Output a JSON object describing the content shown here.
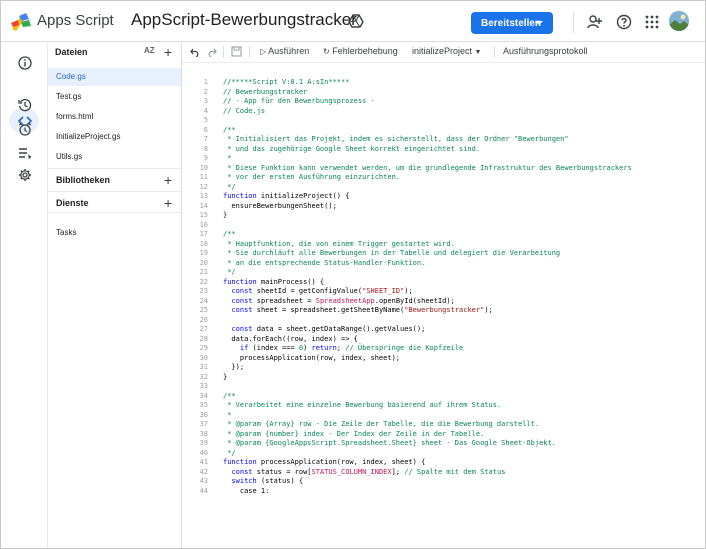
{
  "topbar": {
    "app_name": "Apps Script",
    "project_name": "AppScript-Bewerbungstracker",
    "deploy_label": "Bereitstellen"
  },
  "panel": {
    "files_title": "Dateien",
    "sort_label": "AZ",
    "files": [
      "Code.gs",
      "Test.gs",
      "forms.html",
      "InitializeProject.gs",
      "Utils.gs"
    ],
    "active_file": "Code.gs",
    "libraries_label": "Bibliotheken",
    "services_label": "Dienste",
    "tasks_label": "Tasks"
  },
  "toolbar": {
    "run_label": "Ausführen",
    "debug_label": "Fehlerbehebung",
    "function_select": "initializeProject",
    "log_label": "Ausführungsprotokoll"
  },
  "colors": {
    "accent": "#1a73e8",
    "active_bg": "#e8f0fe",
    "comment": "#098658",
    "keyword": "#0000ff",
    "string": "#a31515",
    "class": "#c2185b"
  },
  "code_lines": [
    [
      [
        "comment",
        "//*****Script V:0.1 A:sIn*****"
      ]
    ],
    [
      [
        "comment",
        "// Bewerbungstracker"
      ]
    ],
    [
      [
        "comment",
        "// - App für den Bewerbungsprozess -"
      ]
    ],
    [
      [
        "comment",
        "// Code.js"
      ]
    ],
    [],
    [
      [
        "comment",
        "/**"
      ]
    ],
    [
      [
        "comment",
        " * Initialisiert das Projekt, indem es sicherstellt, dass der Ordner \"Bewerbungen\""
      ]
    ],
    [
      [
        "comment",
        " * und das zugehörige Google Sheet korrekt eingerichtet sind."
      ]
    ],
    [
      [
        "comment",
        " *"
      ]
    ],
    [
      [
        "comment",
        " * Diese Funktion kann verwendet werden, um die grundlegende Infrastruktur des Bewerbungstrackers"
      ]
    ],
    [
      [
        "comment",
        " * vor der ersten Ausführung einzurichten."
      ]
    ],
    [
      [
        "comment",
        " */"
      ]
    ],
    [
      [
        "keyword",
        "function"
      ],
      [
        "default",
        " initializeProject() {"
      ]
    ],
    [
      [
        "default",
        "  ensureBewerbungenSheet();"
      ]
    ],
    [
      [
        "default",
        "}"
      ]
    ],
    [],
    [
      [
        "comment",
        "/**"
      ]
    ],
    [
      [
        "comment",
        " * Hauptfunktion, die von einem Trigger gestartet wird."
      ]
    ],
    [
      [
        "comment",
        " * Sie durchläuft alle Bewerbungen in der Tabelle und delegiert die Verarbeitung"
      ]
    ],
    [
      [
        "comment",
        " * an die entsprechende Status-Handler-Funktion."
      ]
    ],
    [
      [
        "comment",
        " */"
      ]
    ],
    [
      [
        "keyword",
        "function"
      ],
      [
        "default",
        " mainProcess() {"
      ]
    ],
    [
      [
        "default",
        "  "
      ],
      [
        "keyword",
        "const"
      ],
      [
        "default",
        " sheetId = getConfigValue("
      ],
      [
        "string",
        "\"SHEET_ID\""
      ],
      [
        "default",
        ");"
      ]
    ],
    [
      [
        "default",
        "  "
      ],
      [
        "keyword",
        "const"
      ],
      [
        "default",
        " spreadsheet = "
      ],
      [
        "class",
        "SpreadsheetApp"
      ],
      [
        "default",
        ".openById(sheetId);"
      ]
    ],
    [
      [
        "default",
        "  "
      ],
      [
        "keyword",
        "const"
      ],
      [
        "default",
        " sheet = spreadsheet.getSheetByName("
      ],
      [
        "string",
        "\"Bewerbungstracker\""
      ],
      [
        "default",
        ");"
      ]
    ],
    [],
    [
      [
        "default",
        "  "
      ],
      [
        "keyword",
        "const"
      ],
      [
        "default",
        " data = sheet.getDataRange().getValues();"
      ]
    ],
    [
      [
        "default",
        "  data.forEach((row, index) => {"
      ]
    ],
    [
      [
        "default",
        "    "
      ],
      [
        "keyword",
        "if"
      ],
      [
        "default",
        " (index === "
      ],
      [
        "number",
        "0"
      ],
      [
        "default",
        ") "
      ],
      [
        "keyword",
        "return"
      ],
      [
        "default",
        "; "
      ],
      [
        "comment",
        "// Überspringe die Kopfzeile"
      ]
    ],
    [
      [
        "default",
        "    processApplication(row, index, sheet);"
      ]
    ],
    [
      [
        "default",
        "  });"
      ]
    ],
    [
      [
        "default",
        "}"
      ]
    ],
    [],
    [
      [
        "comment",
        "/**"
      ]
    ],
    [
      [
        "comment",
        " * Verarbeitet eine einzelne Bewerbung basierend auf ihrem Status."
      ]
    ],
    [
      [
        "comment",
        " *"
      ]
    ],
    [
      [
        "comment",
        " * @param {Array} row - Die Zeile der Tabelle, die die Bewerbung darstellt."
      ]
    ],
    [
      [
        "comment",
        " * @param {number} index - Der Index der Zeile in der Tabelle."
      ]
    ],
    [
      [
        "comment",
        " * @param {GoogleAppsScript.Spreadsheet.Sheet} sheet - Das Google Sheet-Objekt."
      ]
    ],
    [
      [
        "comment",
        " */"
      ]
    ],
    [
      [
        "keyword",
        "function"
      ],
      [
        "default",
        " processApplication(row, index, sheet) {"
      ]
    ],
    [
      [
        "default",
        "  "
      ],
      [
        "keyword",
        "const"
      ],
      [
        "default",
        " status = row["
      ],
      [
        "class",
        "STATUS_COLUMN_INDEX"
      ],
      [
        "default",
        "]; "
      ],
      [
        "comment",
        "// Spalte mit dem Status"
      ]
    ],
    [
      [
        "default",
        "  "
      ],
      [
        "keyword",
        "switch"
      ],
      [
        "default",
        " (status) {"
      ]
    ],
    [
      [
        "default",
        "    case 1:"
      ]
    ]
  ]
}
